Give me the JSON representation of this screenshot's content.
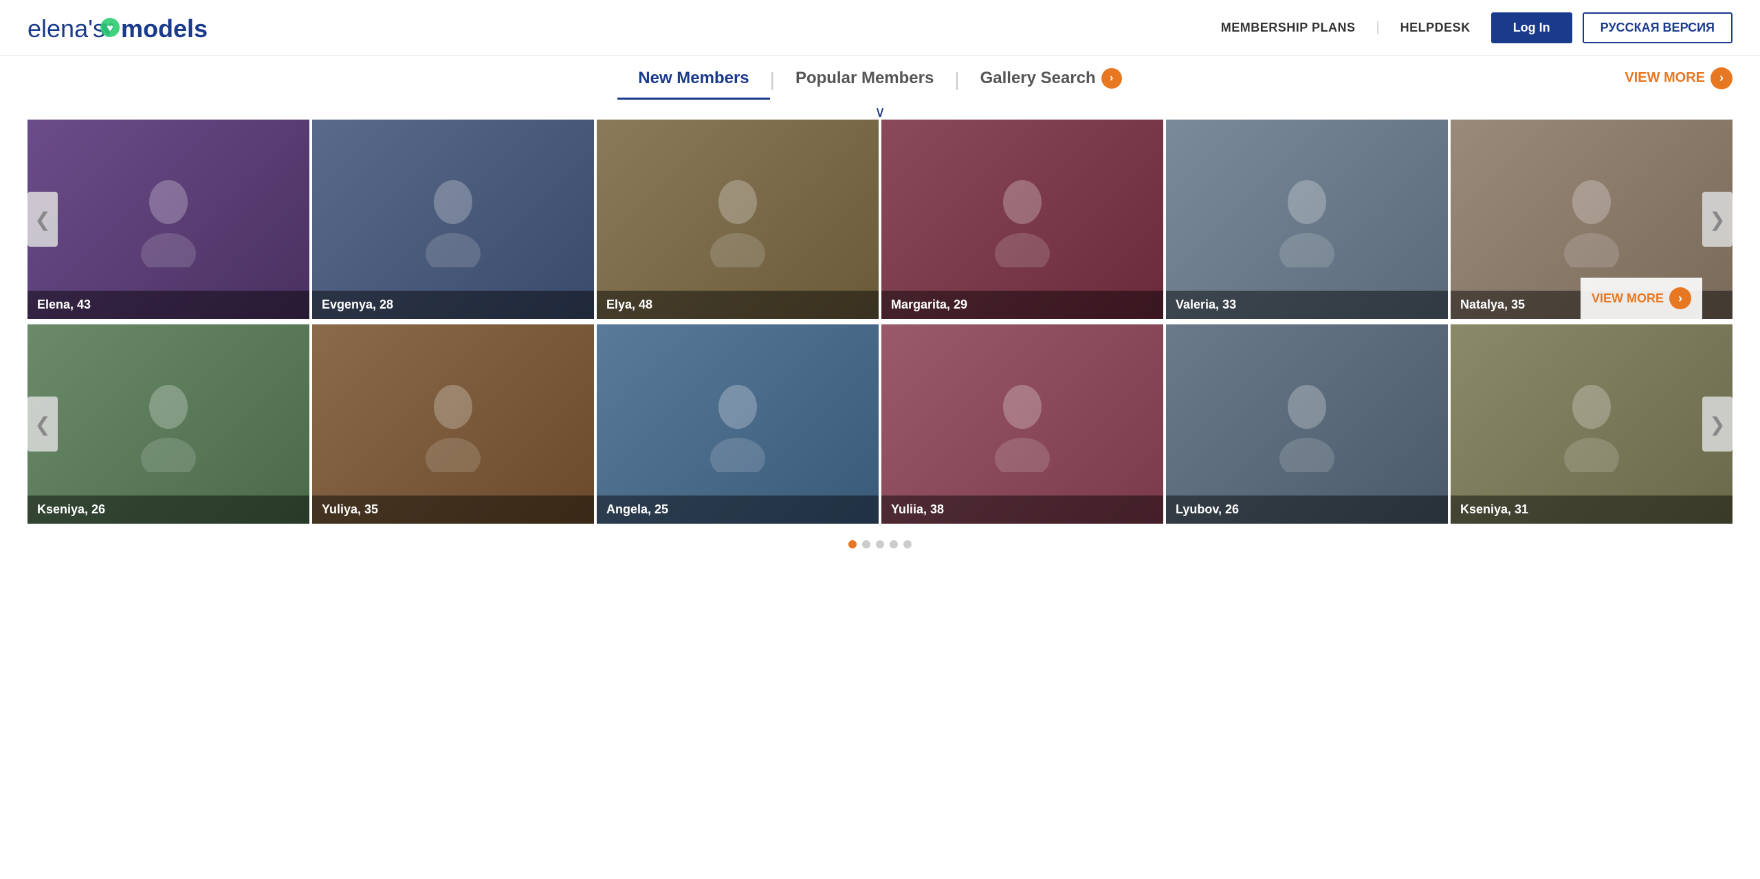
{
  "header": {
    "logo": {
      "prefix": "elena's",
      "heart": "♥",
      "suffix": "models"
    },
    "nav": {
      "membership_plans": "MEMBERSHIP PLANS",
      "helpdesk": "HELPDESK",
      "login": "Log In",
      "russian": "РУССКАЯ ВЕРСИЯ"
    }
  },
  "tabs": {
    "new_members": "New Members",
    "popular_members": "Popular Members",
    "gallery_search": "Gallery Search",
    "view_more": "VIEW MORE"
  },
  "row1": {
    "members": [
      {
        "name": "Elena",
        "age": 43,
        "bg": "bg-1"
      },
      {
        "name": "Evgenya",
        "age": 28,
        "bg": "bg-2"
      },
      {
        "name": "Elya",
        "age": 48,
        "bg": "bg-3"
      },
      {
        "name": "Margarita",
        "age": 29,
        "bg": "bg-4"
      },
      {
        "name": "Valeria",
        "age": 33,
        "bg": "bg-5"
      },
      {
        "name": "Natalya",
        "age": 35,
        "bg": "bg-6"
      }
    ]
  },
  "row2": {
    "members": [
      {
        "name": "Kseniya",
        "age": 26,
        "bg": "bg-7"
      },
      {
        "name": "Yuliya",
        "age": 35,
        "bg": "bg-8"
      },
      {
        "name": "Angela",
        "age": 25,
        "bg": "bg-9"
      },
      {
        "name": "Yuliia",
        "age": 38,
        "bg": "bg-10"
      },
      {
        "name": "Lyubov",
        "age": 26,
        "bg": "bg-11"
      },
      {
        "name": "Kseniya",
        "age": 31,
        "bg": "bg-12"
      }
    ]
  },
  "view_more_label": "VIEW MORE",
  "arrow_left": "❮",
  "arrow_right": "❯",
  "pagination": {
    "dots": [
      "active",
      "inactive",
      "inactive",
      "inactive",
      "inactive"
    ]
  }
}
